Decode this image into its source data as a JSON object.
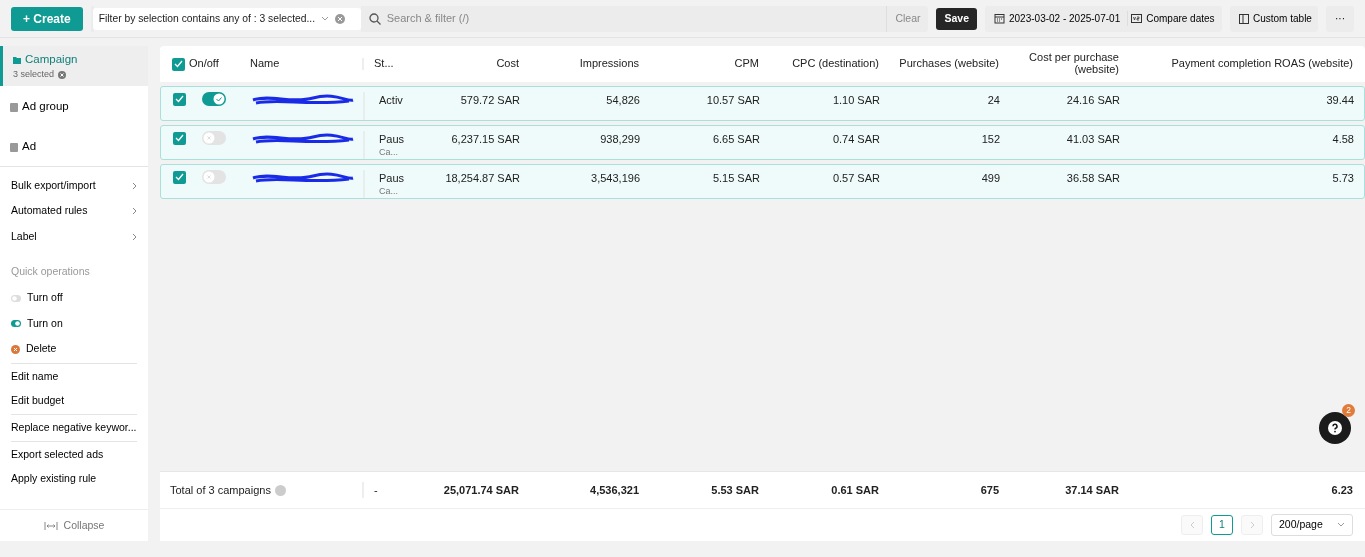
{
  "toolbar": {
    "create": "+ Create",
    "filter": "Filter by selection contains any of : 3 selected...",
    "search": {
      "placeholder": "Search & filter (/)"
    },
    "clear": "Clear",
    "save": "Save",
    "date_range": "2023-03-02 - 2025-07-01",
    "compare_dates": "Compare dates",
    "custom_table": "Custom table",
    "more": "···"
  },
  "sidebar": {
    "levels": [
      {
        "label": "Campaign",
        "sub": "3 selected",
        "selected": true
      },
      {
        "label": "Ad group",
        "selected": false
      },
      {
        "label": "Ad",
        "selected": false
      }
    ],
    "menu": [
      {
        "label": "Bulk export/import"
      },
      {
        "label": "Automated rules"
      },
      {
        "label": "Label"
      }
    ],
    "quick_operations": {
      "title": "Quick operations",
      "items": [
        {
          "label": "Turn off",
          "kind": "off"
        },
        {
          "label": "Turn on",
          "kind": "on"
        },
        {
          "label": "Delete",
          "kind": "delete"
        }
      ]
    },
    "action_groups": [
      [
        "Edit name",
        "Edit budget"
      ],
      [
        "Replace negative keywor..."
      ],
      [
        "Export selected ads",
        "Apply existing rule"
      ]
    ],
    "collapse": "Collapse"
  },
  "table": {
    "select_all": true,
    "columns": [
      "On/off",
      "Name",
      "St...",
      "Cost",
      "Impressions",
      "CPM",
      "CPC (destination)",
      "Purchases (website)",
      "Cost per purchase (website)",
      "Payment completion ROAS (website)"
    ],
    "rows": [
      {
        "checked": true,
        "on": true,
        "status": "Activ",
        "values": [
          "579.72 SAR",
          "54,826",
          "10.57 SAR",
          "1.10 SAR",
          "24",
          "24.16 SAR",
          "39.44"
        ]
      },
      {
        "checked": true,
        "on": false,
        "status": "Paus",
        "status_sub": "Ca...",
        "values": [
          "6,237.15 SAR",
          "938,299",
          "6.65 SAR",
          "0.74 SAR",
          "152",
          "41.03 SAR",
          "4.58"
        ]
      },
      {
        "checked": true,
        "on": false,
        "status": "Paus",
        "status_sub": "Ca...",
        "values": [
          "18,254.87 SAR",
          "3,543,196",
          "5.15 SAR",
          "0.57 SAR",
          "499",
          "36.58 SAR",
          "5.73"
        ]
      }
    ],
    "total": {
      "label": "Total of 3 campaigns",
      "status": "-",
      "values": [
        "25,071.74 SAR",
        "4,536,321",
        "5.53 SAR",
        "0.61 SAR",
        "675",
        "37.14 SAR",
        "6.23"
      ]
    },
    "pagination": {
      "pages": [
        {
          "label": "1",
          "selected": true
        }
      ],
      "page_size": "200/page"
    }
  },
  "help": {
    "badge": "2"
  }
}
